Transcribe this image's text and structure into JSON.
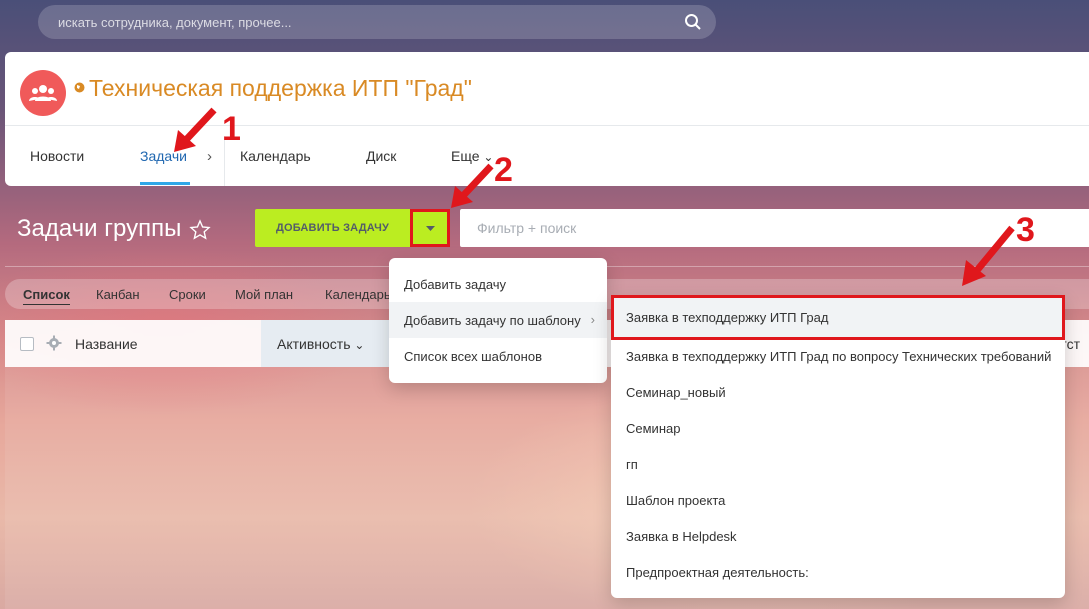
{
  "search": {
    "placeholder": "искать сотрудника, документ, прочее..."
  },
  "group": {
    "title": "Техническая поддержка ИТП \"Град\""
  },
  "tabs": [
    {
      "label": "Новости"
    },
    {
      "label": "Задачи"
    },
    {
      "label": "Календарь"
    },
    {
      "label": "Диск"
    },
    {
      "label": "Еще"
    }
  ],
  "toolbar": {
    "page_title": "Задачи группы",
    "add_task_label": "ДОБАВИТЬ ЗАДАЧУ",
    "filter_placeholder": "Фильтр + поиск"
  },
  "views": [
    {
      "label": "Список"
    },
    {
      "label": "Канбан"
    },
    {
      "label": "Сроки"
    },
    {
      "label": "Мой план"
    },
    {
      "label": "Календарь"
    }
  ],
  "grid": {
    "col_name": "Название",
    "col_activity": "Активность",
    "col_right": "етст"
  },
  "add_menu": {
    "items": [
      {
        "label": "Добавить задачу"
      },
      {
        "label": "Добавить задачу по шаблону"
      },
      {
        "label": "Список всех шаблонов"
      }
    ]
  },
  "template_menu": {
    "items": [
      {
        "label": "Заявка в техподдержку ИТП Град"
      },
      {
        "label": "Заявка в техподдержку ИТП Град по вопросу Технических требований"
      },
      {
        "label": "Семинар_новый"
      },
      {
        "label": "Семинар"
      },
      {
        "label": "гп"
      },
      {
        "label": "Шаблон проекта"
      },
      {
        "label": "Заявка в Helpdesk"
      },
      {
        "label": "Предпроектная деятельность:"
      }
    ]
  },
  "annotations": {
    "a1": "1",
    "a2": "2",
    "a3": "3"
  },
  "colors": {
    "accent_green": "#bbed21",
    "annotation_red": "#e0171c",
    "title_orange": "#d98a24",
    "active_tab": "#2067b0"
  }
}
